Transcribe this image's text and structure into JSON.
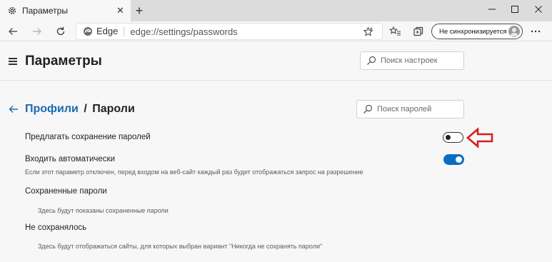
{
  "browser": {
    "tab": {
      "title": "Параметры",
      "icon": "gear-icon"
    },
    "new_tab_label": "+",
    "window_controls": [
      "minimize",
      "maximize",
      "close"
    ]
  },
  "toolbar": {
    "address_brand": "Edge",
    "address_url": "edge://settings/passwords",
    "sync_label": "Не синхронизируется"
  },
  "settings": {
    "title": "Параметры",
    "search_placeholder": "Поиск настроек"
  },
  "page": {
    "breadcrumb_parent": "Профили",
    "breadcrumb_separator": "/",
    "breadcrumb_current": "Пароли",
    "search_placeholder": "Поиск паролей",
    "offer_save": {
      "label": "Предлагать сохранение паролей",
      "enabled": false
    },
    "auto_signin": {
      "label": "Входить автоматически",
      "description": "Если этот параметр отключен, перед входом на веб-сайт каждый раз будет отображаться запрос на разрешение",
      "enabled": true
    },
    "saved_passwords": {
      "heading": "Сохраненные пароли",
      "empty_text": "Здесь будут показаны сохраненные пароли"
    },
    "never_saved": {
      "heading": "Не сохранялось",
      "empty_text": "Здесь будут отображаться сайты, для которых выбран вариант \"Никогда не сохранять пароли\""
    }
  },
  "colors": {
    "accent": "#0a6dc2",
    "link": "#1a6bb0",
    "annotation_arrow": "#d42020"
  }
}
